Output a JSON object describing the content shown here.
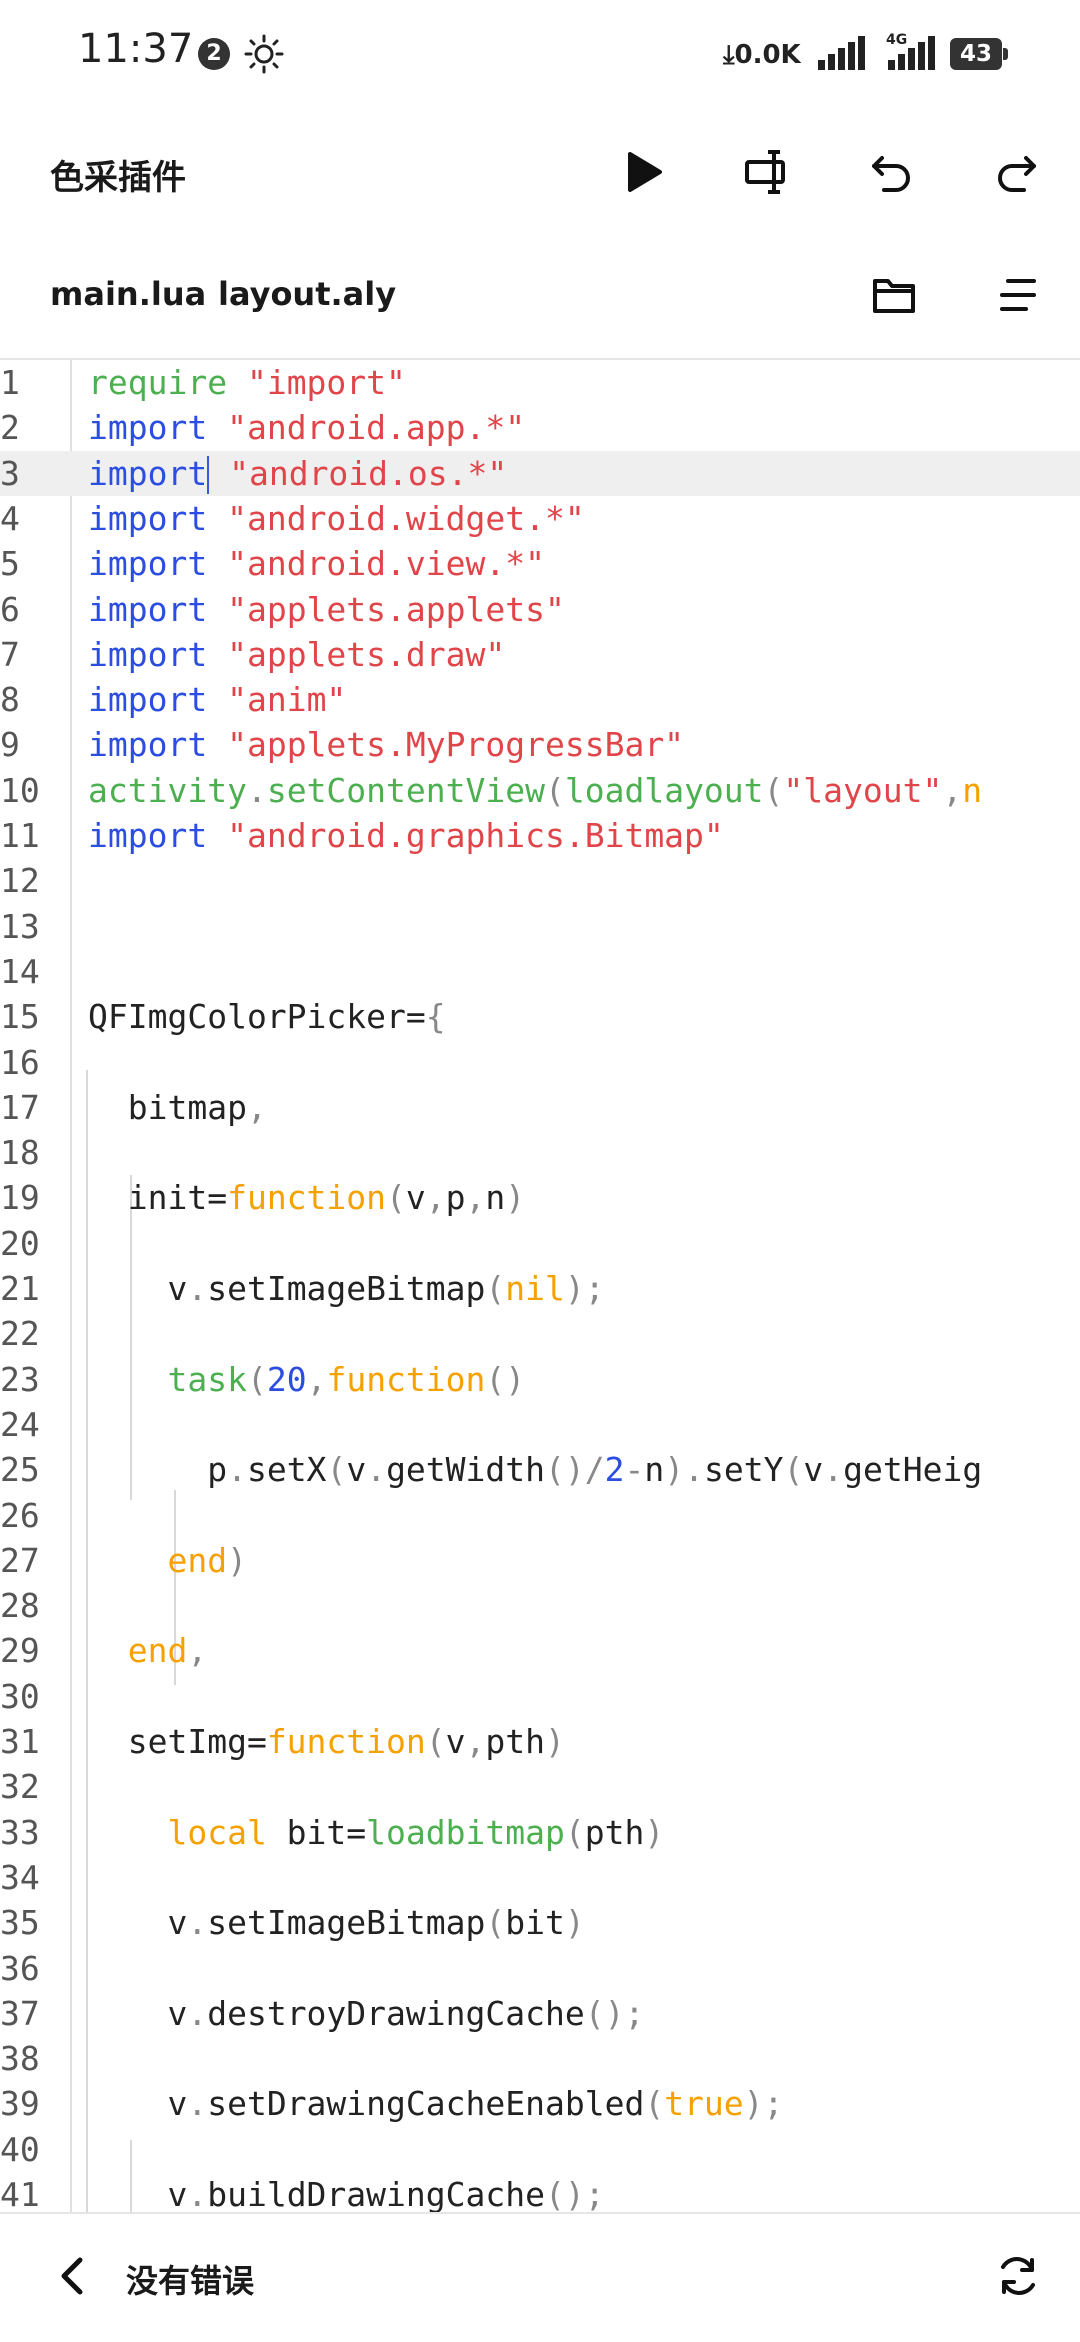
{
  "status_bar": {
    "time": "11:37",
    "notification_count": "2",
    "net_speed": "0.0K",
    "network_type": "4G",
    "battery": "43"
  },
  "toolbar": {
    "title": "色采插件",
    "icons": [
      "play-icon",
      "text-cursor-icon",
      "undo-icon",
      "redo-icon"
    ]
  },
  "tabs": [
    "main.lua",
    "layout.aly"
  ],
  "tab_actions": [
    "folder-icon",
    "menu-lines-icon"
  ],
  "editor": {
    "current_line": 3,
    "lines": [
      {
        "n": "1",
        "tokens": [
          [
            "f",
            "require"
          ],
          [
            "t",
            " "
          ],
          [
            "s",
            "\"import\""
          ]
        ]
      },
      {
        "n": "2",
        "tokens": [
          [
            "k",
            "import"
          ],
          [
            "t",
            " "
          ],
          [
            "s",
            "\"android.app.*\""
          ]
        ]
      },
      {
        "n": "3",
        "tokens": [
          [
            "k",
            "import"
          ],
          [
            "cursor",
            ""
          ],
          [
            "t",
            " "
          ],
          [
            "s",
            "\"android.os.*\""
          ]
        ]
      },
      {
        "n": "4",
        "tokens": [
          [
            "k",
            "import"
          ],
          [
            "t",
            " "
          ],
          [
            "s",
            "\"android.widget.*\""
          ]
        ]
      },
      {
        "n": "5",
        "tokens": [
          [
            "k",
            "import"
          ],
          [
            "t",
            " "
          ],
          [
            "s",
            "\"android.view.*\""
          ]
        ]
      },
      {
        "n": "6",
        "tokens": [
          [
            "k",
            "import"
          ],
          [
            "t",
            " "
          ],
          [
            "s",
            "\"applets.applets\""
          ]
        ]
      },
      {
        "n": "7",
        "tokens": [
          [
            "k",
            "import"
          ],
          [
            "t",
            " "
          ],
          [
            "s",
            "\"applets.draw\""
          ]
        ]
      },
      {
        "n": "8",
        "tokens": [
          [
            "k",
            "import"
          ],
          [
            "t",
            " "
          ],
          [
            "s",
            "\"anim\""
          ]
        ]
      },
      {
        "n": "9",
        "tokens": [
          [
            "k",
            "import"
          ],
          [
            "t",
            " "
          ],
          [
            "s",
            "\"applets.MyProgressBar\""
          ]
        ]
      },
      {
        "n": "10",
        "tokens": [
          [
            "f",
            "activity"
          ],
          [
            "p",
            "."
          ],
          [
            "f",
            "setContentView"
          ],
          [
            "p",
            "("
          ],
          [
            "f",
            "loadlayout"
          ],
          [
            "p",
            "("
          ],
          [
            "s",
            "\"layout\""
          ],
          [
            "p",
            ","
          ],
          [
            "o",
            "n"
          ]
        ]
      },
      {
        "n": "11",
        "tokens": [
          [
            "k",
            "import"
          ],
          [
            "t",
            " "
          ],
          [
            "s",
            "\"android.graphics.Bitmap\""
          ]
        ]
      },
      {
        "n": "12",
        "tokens": []
      },
      {
        "n": "13",
        "tokens": []
      },
      {
        "n": "14",
        "tokens": []
      },
      {
        "n": "15",
        "tokens": [
          [
            "t",
            "QFImgColorPicker="
          ],
          [
            "p",
            "{"
          ]
        ]
      },
      {
        "n": "16",
        "tokens": []
      },
      {
        "n": "17",
        "tokens": [
          [
            "t",
            "  bitmap"
          ],
          [
            "p",
            ","
          ]
        ]
      },
      {
        "n": "18",
        "tokens": []
      },
      {
        "n": "19",
        "tokens": [
          [
            "t",
            "  init="
          ],
          [
            "o",
            "function"
          ],
          [
            "p",
            "("
          ],
          [
            "t",
            "v"
          ],
          [
            "p",
            ","
          ],
          [
            "t",
            "p"
          ],
          [
            "p",
            ","
          ],
          [
            "t",
            "n"
          ],
          [
            "p",
            ")"
          ]
        ]
      },
      {
        "n": "20",
        "tokens": []
      },
      {
        "n": "21",
        "tokens": [
          [
            "t",
            "    v"
          ],
          [
            "p",
            "."
          ],
          [
            "t",
            "setImageBitmap"
          ],
          [
            "p",
            "("
          ],
          [
            "o",
            "nil"
          ],
          [
            "p",
            ");"
          ]
        ]
      },
      {
        "n": "22",
        "tokens": []
      },
      {
        "n": "23",
        "tokens": [
          [
            "f",
            "    task"
          ],
          [
            "p",
            "("
          ],
          [
            "n",
            "20"
          ],
          [
            "p",
            ","
          ],
          [
            "o",
            "function"
          ],
          [
            "p",
            "()"
          ]
        ]
      },
      {
        "n": "24",
        "tokens": []
      },
      {
        "n": "25",
        "tokens": [
          [
            "t",
            "      p"
          ],
          [
            "p",
            "."
          ],
          [
            "t",
            "setX"
          ],
          [
            "p",
            "("
          ],
          [
            "t",
            "v"
          ],
          [
            "p",
            "."
          ],
          [
            "t",
            "getWidth"
          ],
          [
            "p",
            "()/"
          ],
          [
            "n",
            "2"
          ],
          [
            "p",
            "-"
          ],
          [
            "t",
            "n"
          ],
          [
            "p",
            ")."
          ],
          [
            "t",
            "setY"
          ],
          [
            "p",
            "("
          ],
          [
            "t",
            "v"
          ],
          [
            "p",
            "."
          ],
          [
            "t",
            "getHeig"
          ]
        ]
      },
      {
        "n": "26",
        "tokens": []
      },
      {
        "n": "27",
        "tokens": [
          [
            "o",
            "    end"
          ],
          [
            "p",
            ")"
          ]
        ]
      },
      {
        "n": "28",
        "tokens": []
      },
      {
        "n": "29",
        "tokens": [
          [
            "o",
            "  end"
          ],
          [
            "p",
            ","
          ]
        ]
      },
      {
        "n": "30",
        "tokens": []
      },
      {
        "n": "31",
        "tokens": [
          [
            "t",
            "  setImg="
          ],
          [
            "o",
            "function"
          ],
          [
            "p",
            "("
          ],
          [
            "t",
            "v"
          ],
          [
            "p",
            ","
          ],
          [
            "t",
            "pth"
          ],
          [
            "p",
            ")"
          ]
        ]
      },
      {
        "n": "32",
        "tokens": []
      },
      {
        "n": "33",
        "tokens": [
          [
            "o",
            "    local"
          ],
          [
            "t",
            " bit="
          ],
          [
            "f",
            "loadbitmap"
          ],
          [
            "p",
            "("
          ],
          [
            "t",
            "pth"
          ],
          [
            "p",
            ")"
          ]
        ]
      },
      {
        "n": "34",
        "tokens": []
      },
      {
        "n": "35",
        "tokens": [
          [
            "t",
            "    v"
          ],
          [
            "p",
            "."
          ],
          [
            "t",
            "setImageBitmap"
          ],
          [
            "p",
            "("
          ],
          [
            "t",
            "bit"
          ],
          [
            "p",
            ")"
          ]
        ]
      },
      {
        "n": "36",
        "tokens": []
      },
      {
        "n": "37",
        "tokens": [
          [
            "t",
            "    v"
          ],
          [
            "p",
            "."
          ],
          [
            "t",
            "destroyDrawingCache"
          ],
          [
            "p",
            "();"
          ]
        ]
      },
      {
        "n": "38",
        "tokens": []
      },
      {
        "n": "39",
        "tokens": [
          [
            "t",
            "    v"
          ],
          [
            "p",
            "."
          ],
          [
            "t",
            "setDrawingCacheEnabled"
          ],
          [
            "p",
            "("
          ],
          [
            "o",
            "true"
          ],
          [
            "p",
            ");"
          ]
        ]
      },
      {
        "n": "40",
        "tokens": []
      },
      {
        "n": "41",
        "tokens": [
          [
            "t",
            "    v"
          ],
          [
            "p",
            "."
          ],
          [
            "t",
            "buildDrawingCache"
          ],
          [
            "p",
            "();"
          ]
        ]
      }
    ]
  },
  "bottom_bar": {
    "status": "没有错误"
  }
}
